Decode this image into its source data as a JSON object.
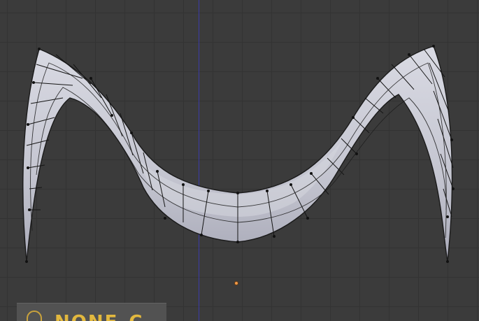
{
  "viewport": {
    "status": {
      "text": "NONE_C",
      "icon": "object-icon",
      "text_color": "#e2b83e"
    },
    "colors": {
      "background": "#3b3b3b",
      "grid": "#333333",
      "axis": "#3a3aa8",
      "mesh_fill": "#c9cad4",
      "wire": "#151515",
      "origin": "#f09a4a"
    }
  }
}
